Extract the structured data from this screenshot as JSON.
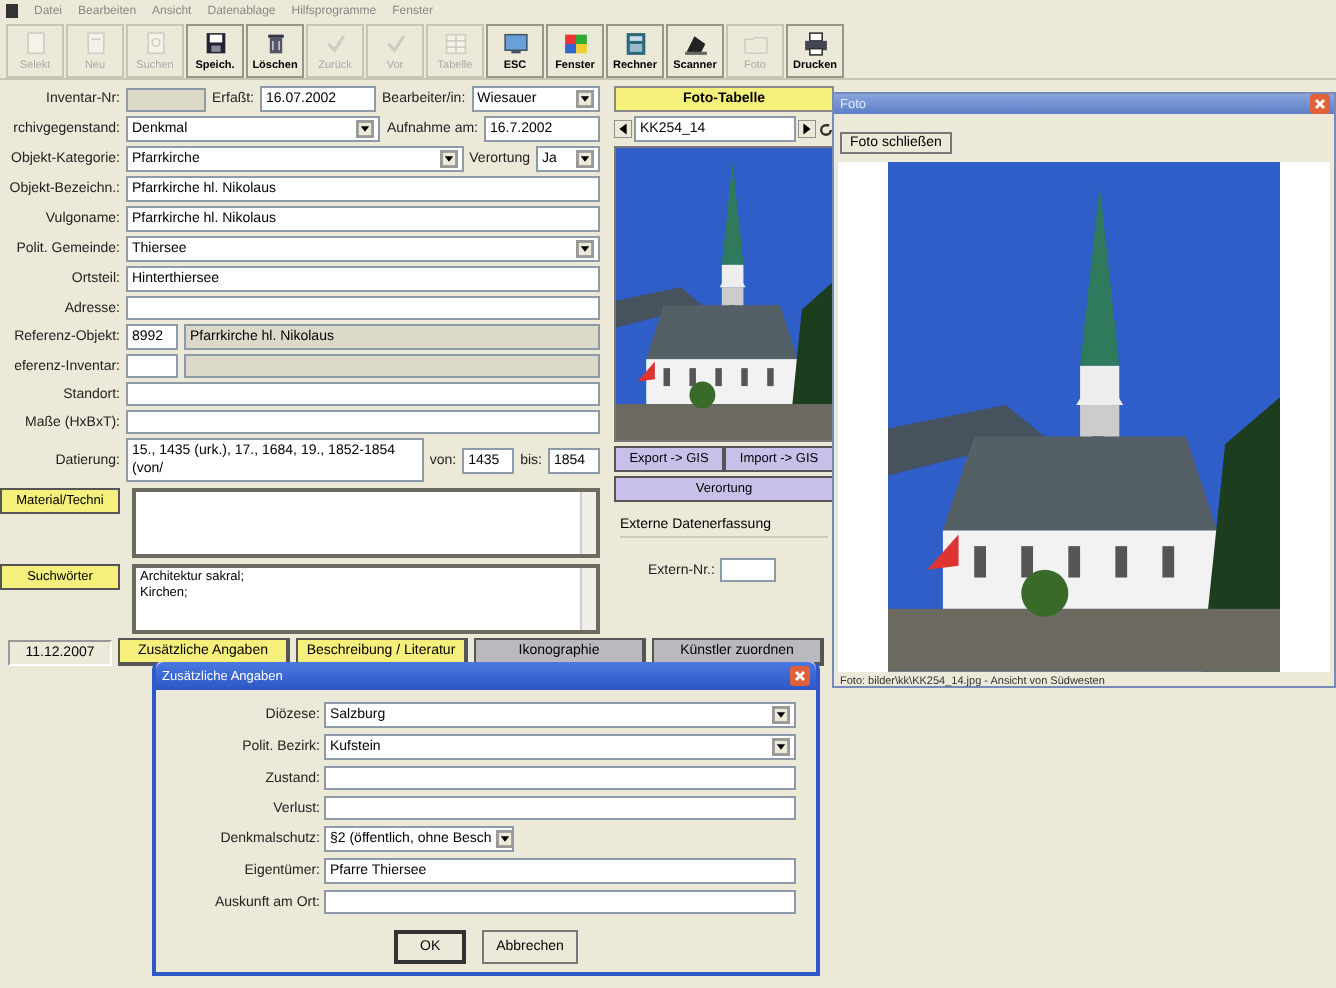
{
  "menu": [
    "Datei",
    "Bearbeiten",
    "Ansicht",
    "Datenablage",
    "Hilfsprogramme",
    "Fenster"
  ],
  "toolbar": [
    {
      "label": "Selekt",
      "disabled": true
    },
    {
      "label": "Neu",
      "disabled": true
    },
    {
      "label": "Suchen",
      "disabled": true
    },
    {
      "label": "Speich.",
      "disabled": false
    },
    {
      "label": "Löschen",
      "disabled": false
    },
    {
      "label": "Zurück",
      "disabled": true
    },
    {
      "label": "Vor",
      "disabled": true
    },
    {
      "label": "Tabelle",
      "disabled": true
    },
    {
      "label": "ESC",
      "disabled": false
    },
    {
      "label": "Fenster",
      "disabled": false
    },
    {
      "label": "Rechner",
      "disabled": false
    },
    {
      "label": "Scanner",
      "disabled": false
    },
    {
      "label": "Foto",
      "disabled": true
    },
    {
      "label": "Drucken",
      "disabled": false
    }
  ],
  "form_rows": [
    {
      "items": [
        {
          "kind": "label",
          "text": "Inventar-Nr:"
        },
        {
          "kind": "short-readonly"
        },
        {
          "kind": "label",
          "text": "Erfaßt:"
        },
        {
          "kind": "short-field",
          "value": "16.07.2002"
        },
        {
          "kind": "label",
          "text": "Bearbeiter/in:"
        },
        {
          "kind": "dropdown",
          "value": "Wiesauer"
        }
      ]
    },
    {
      "items": [
        {
          "kind": "label",
          "text": "rchivgegenstand:"
        },
        {
          "kind": "dropdown",
          "value": "Denkmal"
        },
        {
          "kind": "label",
          "text": "Aufnahme am:"
        },
        {
          "kind": "short-field",
          "value": "16.7.2002"
        }
      ]
    },
    {
      "items": [
        {
          "kind": "label",
          "text": "Objekt-Kategorie:"
        },
        {
          "kind": "dropdown",
          "value": "Pfarrkirche"
        },
        {
          "kind": "label",
          "text": "Verortung"
        },
        {
          "kind": "short-dropdown",
          "value": "Ja"
        }
      ]
    },
    {
      "items": [
        {
          "kind": "label",
          "text": "Objekt-Bezeichn.:"
        },
        {
          "kind": "field",
          "value": "Pfarrkirche hl. Nikolaus"
        }
      ]
    },
    {
      "items": [
        {
          "kind": "label",
          "text": "Vulgoname:"
        },
        {
          "kind": "field",
          "value": "Pfarrkirche hl. Nikolaus"
        }
      ]
    },
    {
      "items": [
        {
          "kind": "label",
          "text": "Polit. Gemeinde:"
        },
        {
          "kind": "dropdown",
          "value": "Thiersee"
        }
      ]
    },
    {
      "items": [
        {
          "kind": "label",
          "text": "Ortsteil:"
        },
        {
          "kind": "field",
          "value": "Hinterthiersee"
        }
      ]
    },
    {
      "items": [
        {
          "kind": "label",
          "text": "Adresse:"
        },
        {
          "kind": "field"
        }
      ]
    },
    {
      "items": [
        {
          "kind": "label",
          "text": "Referenz-Objekt:"
        },
        {
          "kind": "tiny-field",
          "value": "8992"
        },
        {
          "kind": "readonly",
          "value": "Pfarrkirche hl. Nikolaus"
        }
      ]
    },
    {
      "items": [
        {
          "kind": "label",
          "text": "eferenz-Inventar:"
        },
        {
          "kind": "tiny-field"
        },
        {
          "kind": "readonly"
        }
      ]
    },
    {
      "items": [
        {
          "kind": "label",
          "text": "Standort:"
        },
        {
          "kind": "field"
        }
      ]
    },
    {
      "items": [
        {
          "kind": "label",
          "text": "Maße (HxBxT):"
        },
        {
          "kind": "field"
        }
      ]
    },
    {
      "items": [
        {
          "kind": "label",
          "text": "Datierung:"
        },
        {
          "kind": "field",
          "value": "15., 1435 (urk.), 17., 1684, 19., 1852-1854 (von/"
        },
        {
          "kind": "label",
          "text": "von:"
        },
        {
          "kind": "tiny-field",
          "value": "1435"
        },
        {
          "kind": "label",
          "text": "bis:"
        },
        {
          "kind": "tiny-field",
          "value": "1854"
        }
      ]
    },
    {
      "items": [
        {
          "kind": "label-button",
          "text": "Material/Techni"
        },
        {
          "kind": "textarea"
        }
      ]
    },
    {
      "items": [
        {
          "kind": "label-button",
          "text": "Suchwörter"
        },
        {
          "kind": "textarea",
          "value": "Architektur sakral;\nKirchen;"
        }
      ]
    }
  ],
  "photo_panel": {
    "title_button": "Foto-Tabelle",
    "record": "KK254_14",
    "gis_buttons": [
      "Export -> GIS",
      "Import -> GIS"
    ],
    "location_button": "Verortung",
    "group_title": "Externe Datenerfassung",
    "extern_label": "Extern-Nr.:"
  },
  "status_date": "11.12.2007",
  "bottom_tabs": [
    {
      "label": "Zusätzliche Angaben",
      "color": "#f5ef7c"
    },
    {
      "label": "Beschreibung / Literatur",
      "color": "#f5ef7c"
    },
    {
      "label": "Ikonographie",
      "color": "#b9b9bf"
    },
    {
      "label": "Künstler zuordnen",
      "color": "#b9b9bf"
    }
  ],
  "foto_window": {
    "title": "Foto",
    "close_button": "Foto schließen",
    "caption": "Foto: bilder\\kk\\KK254_14.jpg - Ansicht von Südwesten"
  },
  "dialog": {
    "title": "Zusätzliche Angaben",
    "rows": [
      {
        "label": "Diözese:",
        "kind": "dropdown",
        "value": "Salzburg"
      },
      {
        "label": "Polit. Bezirk:",
        "kind": "dropdown",
        "value": "Kufstein"
      },
      {
        "label": "Zustand:",
        "kind": "field"
      },
      {
        "label": "Verlust:",
        "kind": "field"
      },
      {
        "label": "Denkmalschutz:",
        "kind": "short-dropdown",
        "value": "§2 (öffentlich, ohne Besch"
      },
      {
        "label": "Eigentümer:",
        "kind": "field",
        "value": "Pfarre Thiersee"
      },
      {
        "label": "Auskunft am Ort:",
        "kind": "field"
      }
    ],
    "buttons": [
      {
        "label": "OK",
        "default": true
      },
      {
        "label": "Abbrechen",
        "default": false
      }
    ]
  }
}
